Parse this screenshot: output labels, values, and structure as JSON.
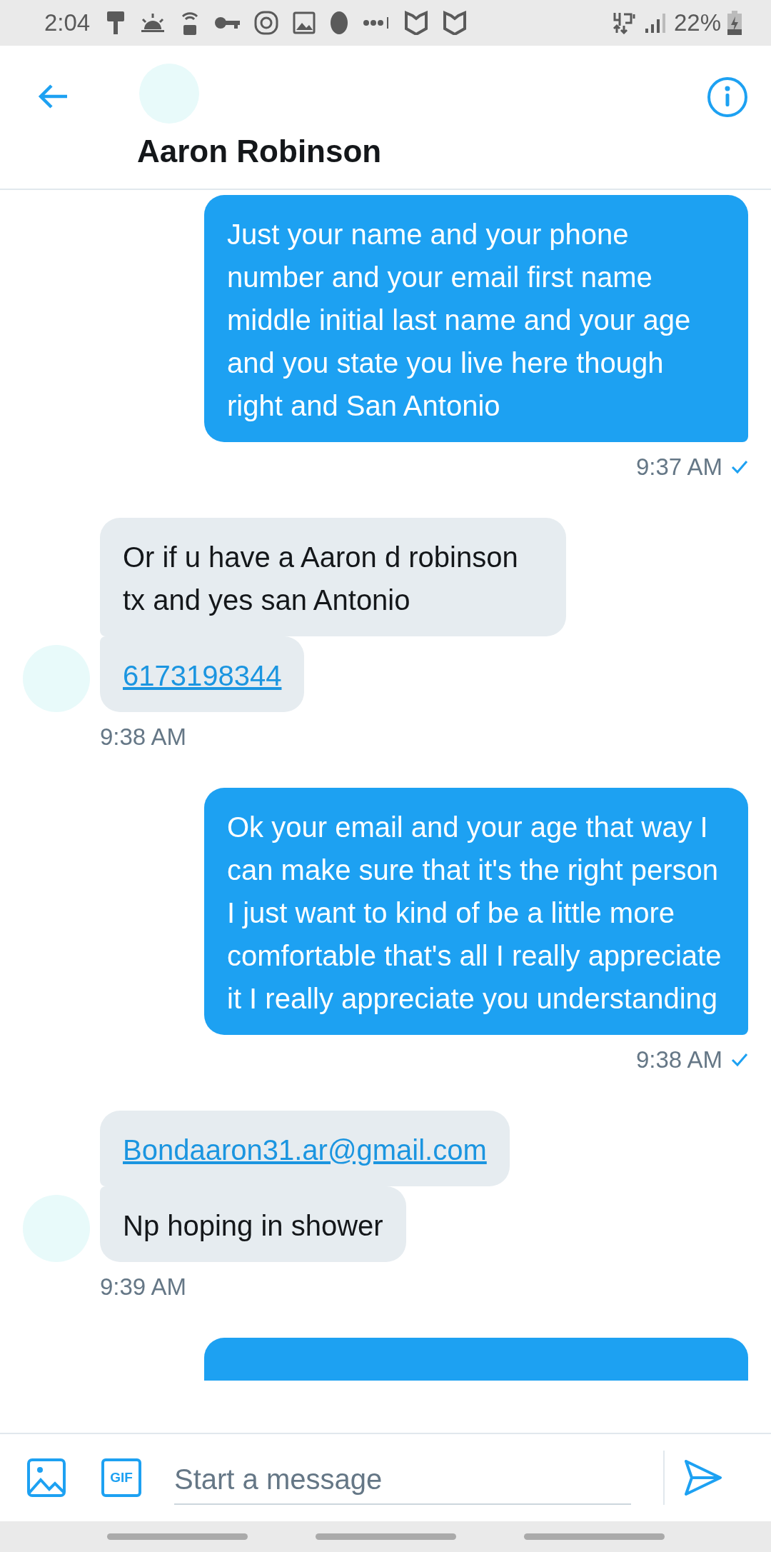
{
  "status_bar": {
    "time": "2:04",
    "battery": "22%"
  },
  "header": {
    "name": "Aaron Robinson"
  },
  "groups": [
    {
      "kind": "sent",
      "messages": [
        {
          "kind": "text",
          "text": "Just your name and your phone number and your email first name middle initial last name and your age and you state you live here though right and San Antonio"
        }
      ],
      "time": "9:37 AM",
      "read": true
    },
    {
      "kind": "received",
      "messages": [
        {
          "kind": "text",
          "text": "Or if u have a Aaron d robinson tx and yes san Antonio"
        },
        {
          "kind": "link",
          "text": "6173198344"
        }
      ],
      "time": "9:38 AM"
    },
    {
      "kind": "sent",
      "messages": [
        {
          "kind": "text",
          "text": "Ok your email and your age that way I can make sure that it's the right person I just want to kind of be a little more comfortable that's all I really appreciate it I really appreciate you understanding"
        }
      ],
      "time": "9:38 AM",
      "read": true
    },
    {
      "kind": "received",
      "messages": [
        {
          "kind": "link",
          "text": "Bondaaron31.ar@gmail.com"
        },
        {
          "kind": "text",
          "text": "Np hoping in shower"
        }
      ],
      "time": "9:39 AM"
    }
  ],
  "composer": {
    "gif_label": "GIF",
    "placeholder": "Start a message"
  }
}
